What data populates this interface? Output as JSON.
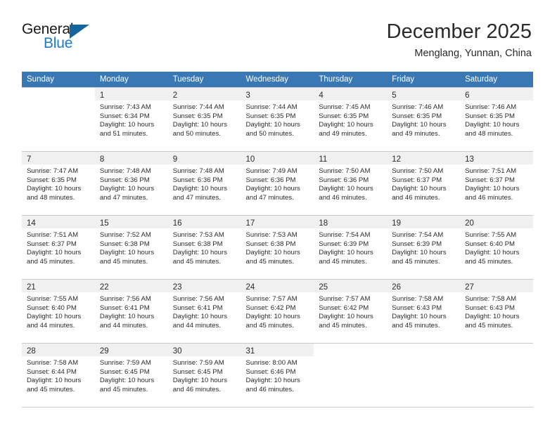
{
  "brand": {
    "word1": "General",
    "word2": "Blue",
    "icon": "triangle-logo-icon",
    "accent": "#1e7ac8",
    "accent_dark": "#15659f"
  },
  "header": {
    "title": "December 2025",
    "subtitle": "Menglang, Yunnan, China"
  },
  "theme": {
    "header_row_bg": "#3a78b5",
    "daynum_band_bg": "#f0f0f0",
    "grid_line": "#c9c9c9",
    "text": "#2b2b2b"
  },
  "columns": [
    "Sunday",
    "Monday",
    "Tuesday",
    "Wednesday",
    "Thursday",
    "Friday",
    "Saturday"
  ],
  "weeks": [
    [
      {
        "day": "",
        "lines": [
          "",
          "",
          "",
          ""
        ]
      },
      {
        "day": "1",
        "lines": [
          "Sunrise: 7:43 AM",
          "Sunset: 6:34 PM",
          "Daylight: 10 hours",
          "and 51 minutes."
        ]
      },
      {
        "day": "2",
        "lines": [
          "Sunrise: 7:44 AM",
          "Sunset: 6:35 PM",
          "Daylight: 10 hours",
          "and 50 minutes."
        ]
      },
      {
        "day": "3",
        "lines": [
          "Sunrise: 7:44 AM",
          "Sunset: 6:35 PM",
          "Daylight: 10 hours",
          "and 50 minutes."
        ]
      },
      {
        "day": "4",
        "lines": [
          "Sunrise: 7:45 AM",
          "Sunset: 6:35 PM",
          "Daylight: 10 hours",
          "and 49 minutes."
        ]
      },
      {
        "day": "5",
        "lines": [
          "Sunrise: 7:46 AM",
          "Sunset: 6:35 PM",
          "Daylight: 10 hours",
          "and 49 minutes."
        ]
      },
      {
        "day": "6",
        "lines": [
          "Sunrise: 7:46 AM",
          "Sunset: 6:35 PM",
          "Daylight: 10 hours",
          "and 48 minutes."
        ]
      }
    ],
    [
      {
        "day": "7",
        "lines": [
          "Sunrise: 7:47 AM",
          "Sunset: 6:35 PM",
          "Daylight: 10 hours",
          "and 48 minutes."
        ]
      },
      {
        "day": "8",
        "lines": [
          "Sunrise: 7:48 AM",
          "Sunset: 6:36 PM",
          "Daylight: 10 hours",
          "and 47 minutes."
        ]
      },
      {
        "day": "9",
        "lines": [
          "Sunrise: 7:48 AM",
          "Sunset: 6:36 PM",
          "Daylight: 10 hours",
          "and 47 minutes."
        ]
      },
      {
        "day": "10",
        "lines": [
          "Sunrise: 7:49 AM",
          "Sunset: 6:36 PM",
          "Daylight: 10 hours",
          "and 47 minutes."
        ]
      },
      {
        "day": "11",
        "lines": [
          "Sunrise: 7:50 AM",
          "Sunset: 6:36 PM",
          "Daylight: 10 hours",
          "and 46 minutes."
        ]
      },
      {
        "day": "12",
        "lines": [
          "Sunrise: 7:50 AM",
          "Sunset: 6:37 PM",
          "Daylight: 10 hours",
          "and 46 minutes."
        ]
      },
      {
        "day": "13",
        "lines": [
          "Sunrise: 7:51 AM",
          "Sunset: 6:37 PM",
          "Daylight: 10 hours",
          "and 46 minutes."
        ]
      }
    ],
    [
      {
        "day": "14",
        "lines": [
          "Sunrise: 7:51 AM",
          "Sunset: 6:37 PM",
          "Daylight: 10 hours",
          "and 45 minutes."
        ]
      },
      {
        "day": "15",
        "lines": [
          "Sunrise: 7:52 AM",
          "Sunset: 6:38 PM",
          "Daylight: 10 hours",
          "and 45 minutes."
        ]
      },
      {
        "day": "16",
        "lines": [
          "Sunrise: 7:53 AM",
          "Sunset: 6:38 PM",
          "Daylight: 10 hours",
          "and 45 minutes."
        ]
      },
      {
        "day": "17",
        "lines": [
          "Sunrise: 7:53 AM",
          "Sunset: 6:38 PM",
          "Daylight: 10 hours",
          "and 45 minutes."
        ]
      },
      {
        "day": "18",
        "lines": [
          "Sunrise: 7:54 AM",
          "Sunset: 6:39 PM",
          "Daylight: 10 hours",
          "and 45 minutes."
        ]
      },
      {
        "day": "19",
        "lines": [
          "Sunrise: 7:54 AM",
          "Sunset: 6:39 PM",
          "Daylight: 10 hours",
          "and 45 minutes."
        ]
      },
      {
        "day": "20",
        "lines": [
          "Sunrise: 7:55 AM",
          "Sunset: 6:40 PM",
          "Daylight: 10 hours",
          "and 45 minutes."
        ]
      }
    ],
    [
      {
        "day": "21",
        "lines": [
          "Sunrise: 7:55 AM",
          "Sunset: 6:40 PM",
          "Daylight: 10 hours",
          "and 44 minutes."
        ]
      },
      {
        "day": "22",
        "lines": [
          "Sunrise: 7:56 AM",
          "Sunset: 6:41 PM",
          "Daylight: 10 hours",
          "and 44 minutes."
        ]
      },
      {
        "day": "23",
        "lines": [
          "Sunrise: 7:56 AM",
          "Sunset: 6:41 PM",
          "Daylight: 10 hours",
          "and 44 minutes."
        ]
      },
      {
        "day": "24",
        "lines": [
          "Sunrise: 7:57 AM",
          "Sunset: 6:42 PM",
          "Daylight: 10 hours",
          "and 45 minutes."
        ]
      },
      {
        "day": "25",
        "lines": [
          "Sunrise: 7:57 AM",
          "Sunset: 6:42 PM",
          "Daylight: 10 hours",
          "and 45 minutes."
        ]
      },
      {
        "day": "26",
        "lines": [
          "Sunrise: 7:58 AM",
          "Sunset: 6:43 PM",
          "Daylight: 10 hours",
          "and 45 minutes."
        ]
      },
      {
        "day": "27",
        "lines": [
          "Sunrise: 7:58 AM",
          "Sunset: 6:43 PM",
          "Daylight: 10 hours",
          "and 45 minutes."
        ]
      }
    ],
    [
      {
        "day": "28",
        "lines": [
          "Sunrise: 7:58 AM",
          "Sunset: 6:44 PM",
          "Daylight: 10 hours",
          "and 45 minutes."
        ]
      },
      {
        "day": "29",
        "lines": [
          "Sunrise: 7:59 AM",
          "Sunset: 6:45 PM",
          "Daylight: 10 hours",
          "and 45 minutes."
        ]
      },
      {
        "day": "30",
        "lines": [
          "Sunrise: 7:59 AM",
          "Sunset: 6:45 PM",
          "Daylight: 10 hours",
          "and 46 minutes."
        ]
      },
      {
        "day": "31",
        "lines": [
          "Sunrise: 8:00 AM",
          "Sunset: 6:46 PM",
          "Daylight: 10 hours",
          "and 46 minutes."
        ]
      },
      {
        "day": "",
        "lines": [
          "",
          "",
          "",
          ""
        ]
      },
      {
        "day": "",
        "lines": [
          "",
          "",
          "",
          ""
        ]
      },
      {
        "day": "",
        "lines": [
          "",
          "",
          "",
          ""
        ]
      }
    ]
  ]
}
